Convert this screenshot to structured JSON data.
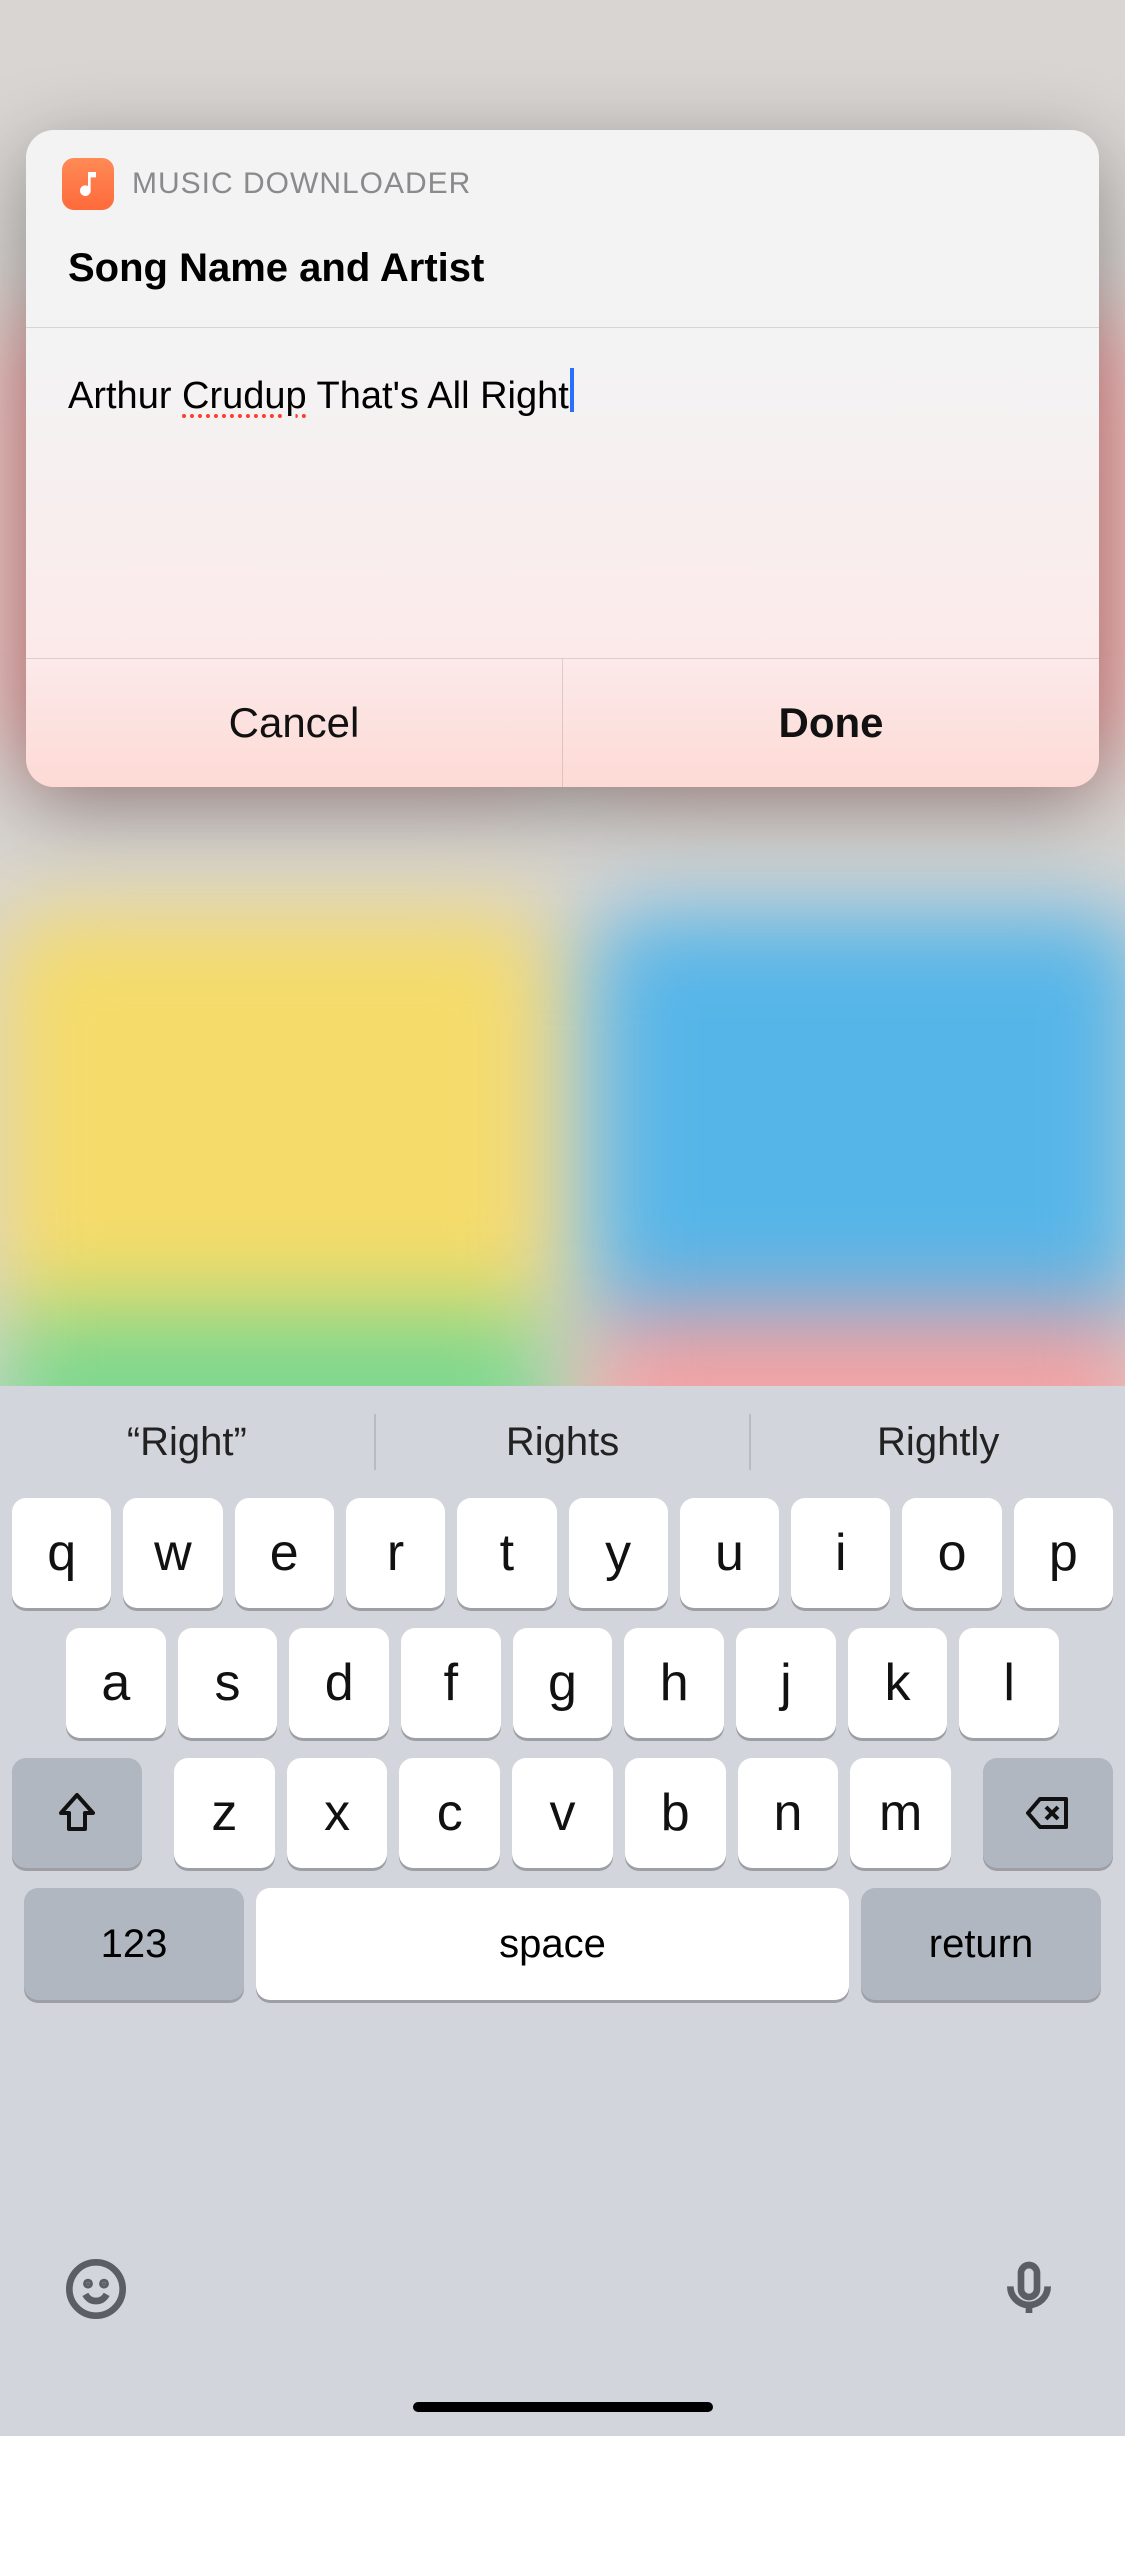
{
  "modal": {
    "app_name": "MUSIC DOWNLOADER",
    "title": "Song Name and Artist",
    "input_pre": "Arthur ",
    "input_spell": "Crudup",
    "input_post": " That's All Right",
    "cancel": "Cancel",
    "done": "Done"
  },
  "keyboard": {
    "suggestions": [
      "“Right”",
      "Rights",
      "Rightly"
    ],
    "row1": [
      "q",
      "w",
      "e",
      "r",
      "t",
      "y",
      "u",
      "i",
      "o",
      "p"
    ],
    "row2": [
      "a",
      "s",
      "d",
      "f",
      "g",
      "h",
      "j",
      "k",
      "l"
    ],
    "row3": [
      "z",
      "x",
      "c",
      "v",
      "b",
      "n",
      "m"
    ],
    "nums": "123",
    "space": "space",
    "return": "return"
  }
}
